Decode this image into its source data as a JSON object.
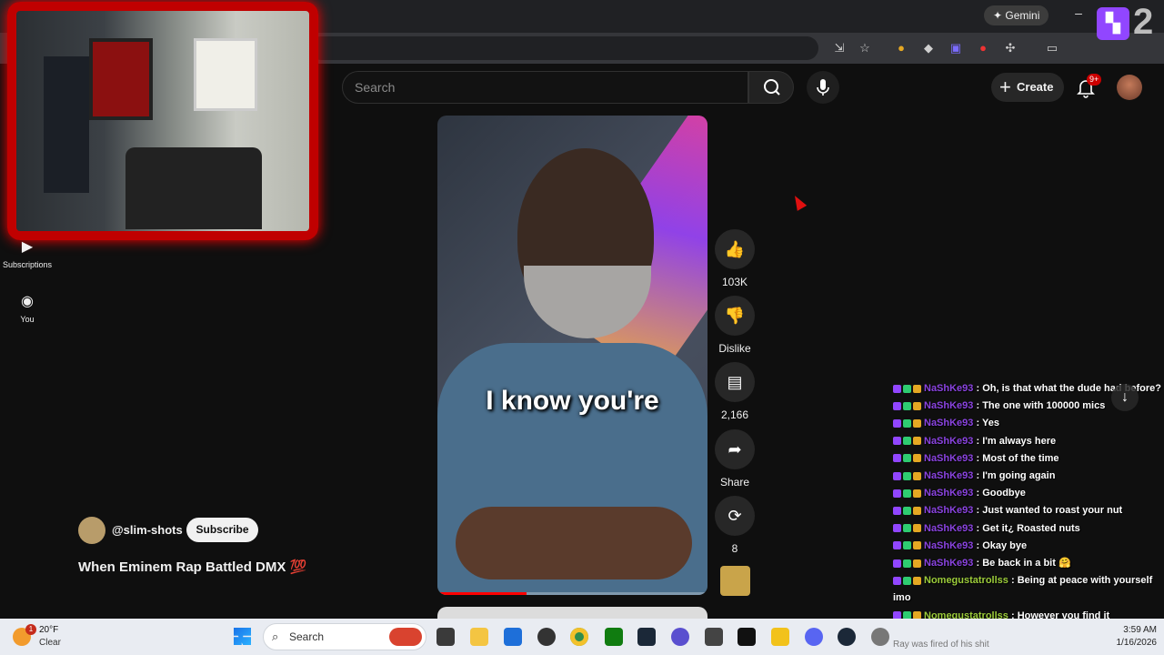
{
  "browser": {
    "gemini_label": "Gemini",
    "minimize_glyph": "–"
  },
  "twitch_badge": {
    "number": "2"
  },
  "nav": {
    "items": [
      {
        "label": "Subscriptions",
        "icon": "subscriptions-icon"
      },
      {
        "label": "You",
        "icon": "account-icon"
      }
    ]
  },
  "header": {
    "search_placeholder": "Search",
    "create_label": "Create",
    "notifications_badge": "9+"
  },
  "video": {
    "caption": "I know you're",
    "progress_fraction": 0.33
  },
  "actions": {
    "like_count": "103K",
    "dislike_label": "Dislike",
    "comment_count": "2,166",
    "share_label": "Share",
    "remix_count": "8"
  },
  "channel": {
    "handle": "@slim-shots",
    "subscribe_label": "Subscribe"
  },
  "title": "When Eminem Rap Battled DMX 💯",
  "chat": {
    "messages": [
      {
        "user": "NaShKe93",
        "text": ": Oh, is that what the dude had before?",
        "color": "#8a43e0"
      },
      {
        "user": "NaShKe93",
        "text": ": The one with 100000 mics",
        "color": "#8a43e0"
      },
      {
        "user": "NaShKe93",
        "text": ": Yes",
        "color": "#8a43e0"
      },
      {
        "user": "NaShKe93",
        "text": ": I'm always here",
        "color": "#8a43e0"
      },
      {
        "user": "NaShKe93",
        "text": ": Most of the time",
        "color": "#8a43e0"
      },
      {
        "user": "NaShKe93",
        "text": ": I'm going again",
        "color": "#8a43e0"
      },
      {
        "user": "NaShKe93",
        "text": ": Goodbye",
        "color": "#8a43e0"
      },
      {
        "user": "NaShKe93",
        "text": ": Just wanted to roast your nut",
        "color": "#8a43e0"
      },
      {
        "user": "NaShKe93",
        "text": ": Get it¿ Roasted nuts",
        "color": "#8a43e0"
      },
      {
        "user": "NaShKe93",
        "text": ": Okay bye",
        "color": "#8a43e0"
      },
      {
        "user": "NaShKe93",
        "text": ": Be back in a bit 🤗",
        "color": "#8a43e0"
      },
      {
        "user": "Nomegustatrollss",
        "text": ": Being at peace with yourself imo",
        "color": "#9ccc3a"
      },
      {
        "user": "Nomegustatrollss",
        "text": ": However you find it",
        "color": "#9ccc3a"
      }
    ],
    "scroll_icon": "arrow-down-icon"
  },
  "taskbar": {
    "weather_temp": "20°F",
    "weather_condition": "Clear",
    "weather_badge": "1",
    "search_label": "Search",
    "clock_time": "3:59 AM",
    "clock_date": "1/16/2026",
    "tray_note": "Ray was fired of his shit"
  },
  "colors": {
    "youtube_bg": "#0f0f0f",
    "accent_red": "#ff0000",
    "twitch_purple": "#9146ff",
    "chat_user_purple": "#8a43e0",
    "chat_user_green": "#9ccc3a"
  }
}
